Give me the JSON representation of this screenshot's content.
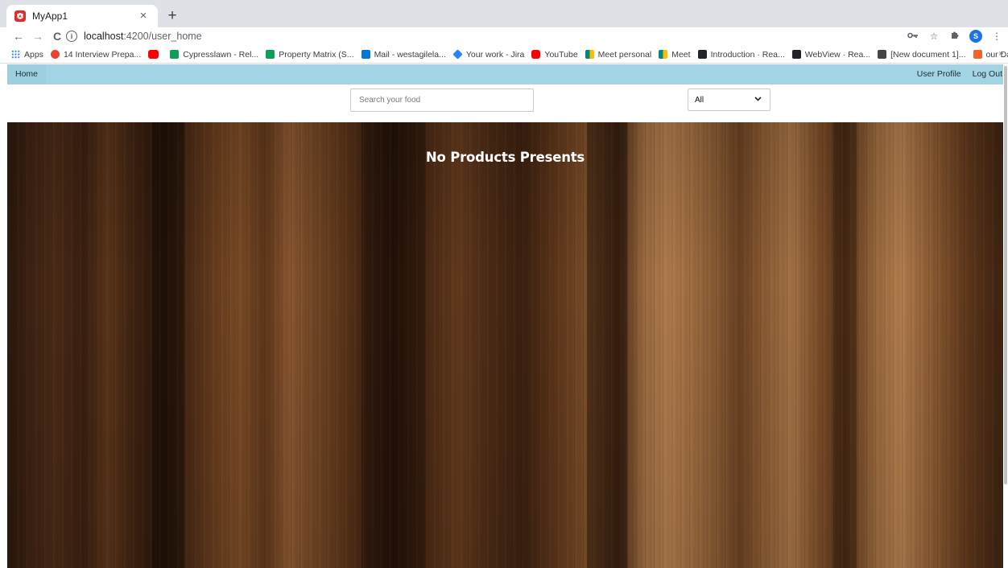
{
  "browser": {
    "tab_title": "MyApp1",
    "tab_close": "×",
    "new_tab": "+",
    "url_host": "localhost",
    "url_path": ":4200/user_home",
    "profile_initial": "S",
    "nav": {
      "back": "←",
      "forward": "→",
      "reload": "C"
    },
    "bookmarks": [
      {
        "label": "Apps",
        "color": "#ea4335"
      },
      {
        "label": "14 Interview Prepa...",
        "color": "#ea4335"
      },
      {
        "label": "",
        "color": "#ff0000"
      },
      {
        "label": "Cypresslawn - Rel...",
        "color": "#0f9d58"
      },
      {
        "label": "Property Matrix (S...",
        "color": "#0f9d58"
      },
      {
        "label": "Mail - westagilela...",
        "color": "#0078d4"
      },
      {
        "label": "Your work - Jira",
        "color": "#2684ff"
      },
      {
        "label": "YouTube",
        "color": "#ff0000"
      },
      {
        "label": "Meet personal",
        "color": "#00897b"
      },
      {
        "label": "Meet",
        "color": "#00897b"
      },
      {
        "label": "Introduction · Rea...",
        "color": "#20232a"
      },
      {
        "label": "WebView · Rea...",
        "color": "#20232a"
      },
      {
        "label": "[New document 1]...",
        "color": "#444444"
      },
      {
        "label": "our Dairay databa...",
        "color": "#f06529"
      }
    ],
    "bookmarks_more": "»"
  },
  "app": {
    "nav": {
      "home": "Home",
      "user_profile": "User Profile",
      "log_out": "Log Out"
    },
    "search": {
      "placeholder": "Search your food",
      "value": ""
    },
    "category_select": {
      "selected": "All"
    },
    "empty_message": "No Products Presents"
  },
  "colors": {
    "nav_bar": "#a3d4e3",
    "hero_text": "#ffffff"
  }
}
